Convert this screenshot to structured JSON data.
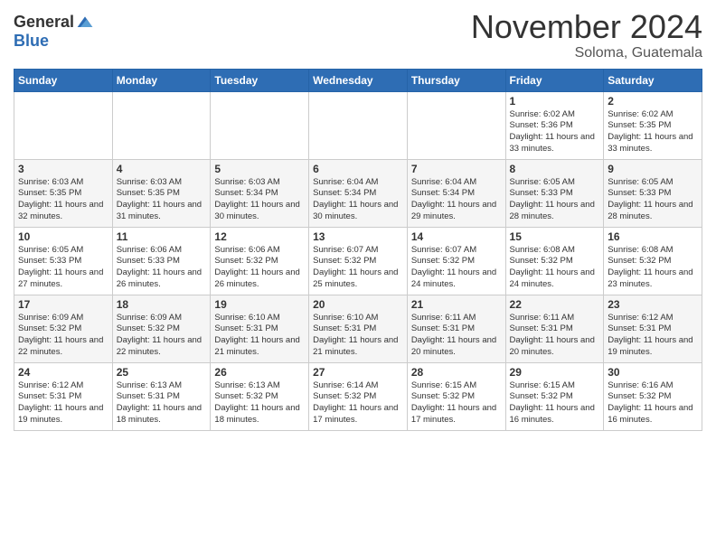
{
  "header": {
    "logo_general": "General",
    "logo_blue": "Blue",
    "month_title": "November 2024",
    "location": "Soloma, Guatemala"
  },
  "weekdays": [
    "Sunday",
    "Monday",
    "Tuesday",
    "Wednesday",
    "Thursday",
    "Friday",
    "Saturday"
  ],
  "weeks": [
    [
      {
        "day": "",
        "info": ""
      },
      {
        "day": "",
        "info": ""
      },
      {
        "day": "",
        "info": ""
      },
      {
        "day": "",
        "info": ""
      },
      {
        "day": "",
        "info": ""
      },
      {
        "day": "1",
        "info": "Sunrise: 6:02 AM\nSunset: 5:36 PM\nDaylight: 11 hours\nand 33 minutes."
      },
      {
        "day": "2",
        "info": "Sunrise: 6:02 AM\nSunset: 5:35 PM\nDaylight: 11 hours\nand 33 minutes."
      }
    ],
    [
      {
        "day": "3",
        "info": "Sunrise: 6:03 AM\nSunset: 5:35 PM\nDaylight: 11 hours\nand 32 minutes."
      },
      {
        "day": "4",
        "info": "Sunrise: 6:03 AM\nSunset: 5:35 PM\nDaylight: 11 hours\nand 31 minutes."
      },
      {
        "day": "5",
        "info": "Sunrise: 6:03 AM\nSunset: 5:34 PM\nDaylight: 11 hours\nand 30 minutes."
      },
      {
        "day": "6",
        "info": "Sunrise: 6:04 AM\nSunset: 5:34 PM\nDaylight: 11 hours\nand 30 minutes."
      },
      {
        "day": "7",
        "info": "Sunrise: 6:04 AM\nSunset: 5:34 PM\nDaylight: 11 hours\nand 29 minutes."
      },
      {
        "day": "8",
        "info": "Sunrise: 6:05 AM\nSunset: 5:33 PM\nDaylight: 11 hours\nand 28 minutes."
      },
      {
        "day": "9",
        "info": "Sunrise: 6:05 AM\nSunset: 5:33 PM\nDaylight: 11 hours\nand 28 minutes."
      }
    ],
    [
      {
        "day": "10",
        "info": "Sunrise: 6:05 AM\nSunset: 5:33 PM\nDaylight: 11 hours\nand 27 minutes."
      },
      {
        "day": "11",
        "info": "Sunrise: 6:06 AM\nSunset: 5:33 PM\nDaylight: 11 hours\nand 26 minutes."
      },
      {
        "day": "12",
        "info": "Sunrise: 6:06 AM\nSunset: 5:32 PM\nDaylight: 11 hours\nand 26 minutes."
      },
      {
        "day": "13",
        "info": "Sunrise: 6:07 AM\nSunset: 5:32 PM\nDaylight: 11 hours\nand 25 minutes."
      },
      {
        "day": "14",
        "info": "Sunrise: 6:07 AM\nSunset: 5:32 PM\nDaylight: 11 hours\nand 24 minutes."
      },
      {
        "day": "15",
        "info": "Sunrise: 6:08 AM\nSunset: 5:32 PM\nDaylight: 11 hours\nand 24 minutes."
      },
      {
        "day": "16",
        "info": "Sunrise: 6:08 AM\nSunset: 5:32 PM\nDaylight: 11 hours\nand 23 minutes."
      }
    ],
    [
      {
        "day": "17",
        "info": "Sunrise: 6:09 AM\nSunset: 5:32 PM\nDaylight: 11 hours\nand 22 minutes."
      },
      {
        "day": "18",
        "info": "Sunrise: 6:09 AM\nSunset: 5:32 PM\nDaylight: 11 hours\nand 22 minutes."
      },
      {
        "day": "19",
        "info": "Sunrise: 6:10 AM\nSunset: 5:31 PM\nDaylight: 11 hours\nand 21 minutes."
      },
      {
        "day": "20",
        "info": "Sunrise: 6:10 AM\nSunset: 5:31 PM\nDaylight: 11 hours\nand 21 minutes."
      },
      {
        "day": "21",
        "info": "Sunrise: 6:11 AM\nSunset: 5:31 PM\nDaylight: 11 hours\nand 20 minutes."
      },
      {
        "day": "22",
        "info": "Sunrise: 6:11 AM\nSunset: 5:31 PM\nDaylight: 11 hours\nand 20 minutes."
      },
      {
        "day": "23",
        "info": "Sunrise: 6:12 AM\nSunset: 5:31 PM\nDaylight: 11 hours\nand 19 minutes."
      }
    ],
    [
      {
        "day": "24",
        "info": "Sunrise: 6:12 AM\nSunset: 5:31 PM\nDaylight: 11 hours\nand 19 minutes."
      },
      {
        "day": "25",
        "info": "Sunrise: 6:13 AM\nSunset: 5:31 PM\nDaylight: 11 hours\nand 18 minutes."
      },
      {
        "day": "26",
        "info": "Sunrise: 6:13 AM\nSunset: 5:32 PM\nDaylight: 11 hours\nand 18 minutes."
      },
      {
        "day": "27",
        "info": "Sunrise: 6:14 AM\nSunset: 5:32 PM\nDaylight: 11 hours\nand 17 minutes."
      },
      {
        "day": "28",
        "info": "Sunrise: 6:15 AM\nSunset: 5:32 PM\nDaylight: 11 hours\nand 17 minutes."
      },
      {
        "day": "29",
        "info": "Sunrise: 6:15 AM\nSunset: 5:32 PM\nDaylight: 11 hours\nand 16 minutes."
      },
      {
        "day": "30",
        "info": "Sunrise: 6:16 AM\nSunset: 5:32 PM\nDaylight: 11 hours\nand 16 minutes."
      }
    ]
  ]
}
